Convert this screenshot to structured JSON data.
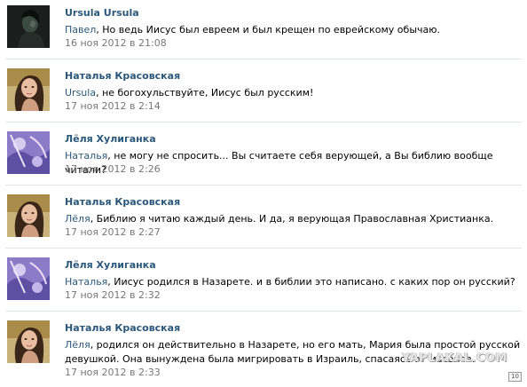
{
  "comments": [
    {
      "author": "Ursula Ursula",
      "mention": "Павел",
      "text": ", Но ведь Иисус был евреем и был крещен по еврейскому обычаю.",
      "time": "16 ноя 2012 в 21:08",
      "avatar": "dark-portrait"
    },
    {
      "author": "Наталья Красовская",
      "mention": "Ursula",
      "text": ", не богохульствуйте, Иисус был русским!",
      "time": "17 ноя 2012 в 2:14",
      "avatar": "woman-portrait"
    },
    {
      "author": "Лёля Хулиганка",
      "mention": "Наталья",
      "text": ", не могу не спросить... Вы считаете себя верующей, а Вы библию вообще читали?",
      "time": "17 ноя 2012 в 2:26",
      "avatar": "purple-abstract"
    },
    {
      "author": "Наталья Красовская",
      "mention": "Лёля",
      "text": ", Библию я читаю каждый день. И да, я верующая Православная Христианка.",
      "time": "17 ноя 2012 в 2:27",
      "avatar": "woman-portrait"
    },
    {
      "author": "Лёля Хулиганка",
      "mention": "Наталья",
      "text": ", Иисус родился в Назарете. и в библии это написано. с каких пор он русский?",
      "time": "17 ноя 2012 в 2:32",
      "avatar": "purple-abstract"
    },
    {
      "author": "Наталья Красовская",
      "mention": "Лёля",
      "text": ", родился он действительно в Назарете, но его мать, Мария была простой русской девушкой. Она вынуждена была мигрировать в Израиль, спасаясь от масонов.",
      "time": "17 ноя 2012 в 2:33",
      "avatar": "woman-portrait"
    }
  ],
  "watermark": "YAPLAKAL.COM",
  "corner_badge": "10",
  "colors": {
    "author": "#2b587a",
    "mention": "#2b587a",
    "time": "#777777",
    "divider": "#dfe5ec"
  }
}
